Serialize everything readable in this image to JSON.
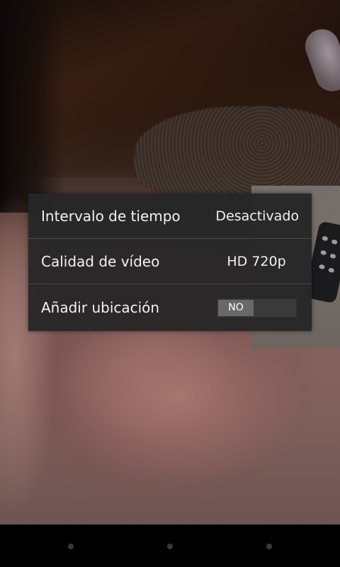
{
  "settings": {
    "items": [
      {
        "label": "Intervalo de tiempo",
        "value": "Desactivado"
      },
      {
        "label": "Calidad de vídeo",
        "value": "HD 720p"
      },
      {
        "label": "Añadir ubicación",
        "toggle": "NO"
      }
    ]
  },
  "navbar": {
    "icons": [
      "back-icon",
      "home-icon",
      "recent-apps-icon"
    ]
  },
  "colors": {
    "popup_bg": "#262626",
    "divider": "#4a4a4a",
    "text": "#f2f2f2",
    "toggle_thumb": "#686868"
  }
}
